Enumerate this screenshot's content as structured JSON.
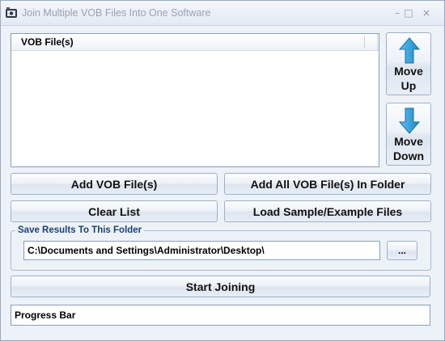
{
  "window": {
    "title": "Join Multiple VOB Files Into One Software",
    "controls": {
      "minimize": "–",
      "maximize": "□",
      "close": "×"
    }
  },
  "file_list": {
    "column_header": "VOB File(s)",
    "items": []
  },
  "side_buttons": {
    "move_up": {
      "line1": "Move",
      "line2": "Up",
      "icon": "arrow-up-icon"
    },
    "move_down": {
      "line1": "Move",
      "line2": "Down",
      "icon": "arrow-down-icon"
    }
  },
  "actions": {
    "add_files": "Add VOB File(s)",
    "add_folder": "Add All VOB File(s) In Folder",
    "clear_list": "Clear List",
    "load_samples": "Load Sample/Example Files"
  },
  "output": {
    "group_label": "Save Results To This Folder",
    "folder_path": "C:\\Documents and Settings\\Administrator\\Desktop\\",
    "browse_label": "..."
  },
  "start_label": "Start Joining",
  "progress": {
    "label": "Progress Bar"
  },
  "colors": {
    "arrow": "#2a9ad6",
    "group_label": "#1a3f7a"
  }
}
